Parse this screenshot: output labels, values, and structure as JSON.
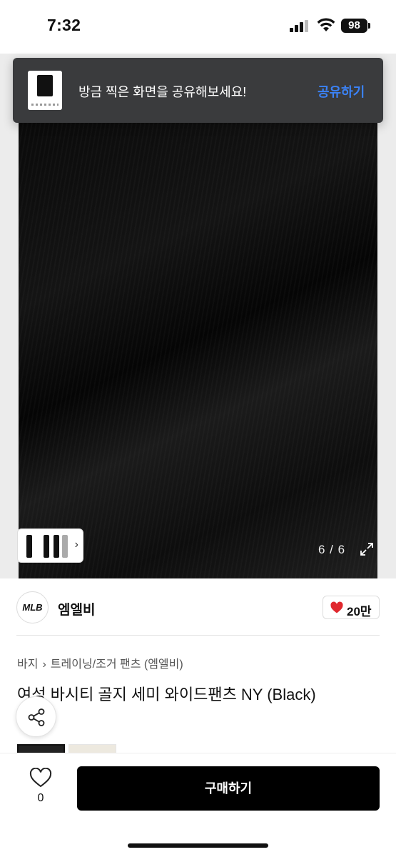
{
  "status_bar": {
    "time": "7:32",
    "battery": "98"
  },
  "toast": {
    "message": "방금 찍은 화면을 공유해보세요!",
    "action_label": "공유하기"
  },
  "gallery": {
    "counter": "6 / 6"
  },
  "brand": {
    "logo_text": "MLB",
    "name": "엠엘비",
    "like_count": "20만"
  },
  "breadcrumb": {
    "category": "바지",
    "subcategory": "트레이닝/조거 팬츠 (엠엘비)"
  },
  "product": {
    "title": "여성 바시티 골지 세미 와이드팬츠 NY (Black)"
  },
  "bottom_bar": {
    "wish_count": "0",
    "buy_label": "구매하기"
  },
  "icons": {
    "signal": "cellular-signal-icon",
    "wifi": "wifi-icon",
    "expand": "expand-icon",
    "heart": "heart-icon",
    "share": "share-icon",
    "chevron": "chevron-right-icon"
  },
  "colors": {
    "accent": "#3b82f6",
    "like": "#e0282e",
    "primary_button": "#000000",
    "toast_bg": "#3a3b3d"
  }
}
